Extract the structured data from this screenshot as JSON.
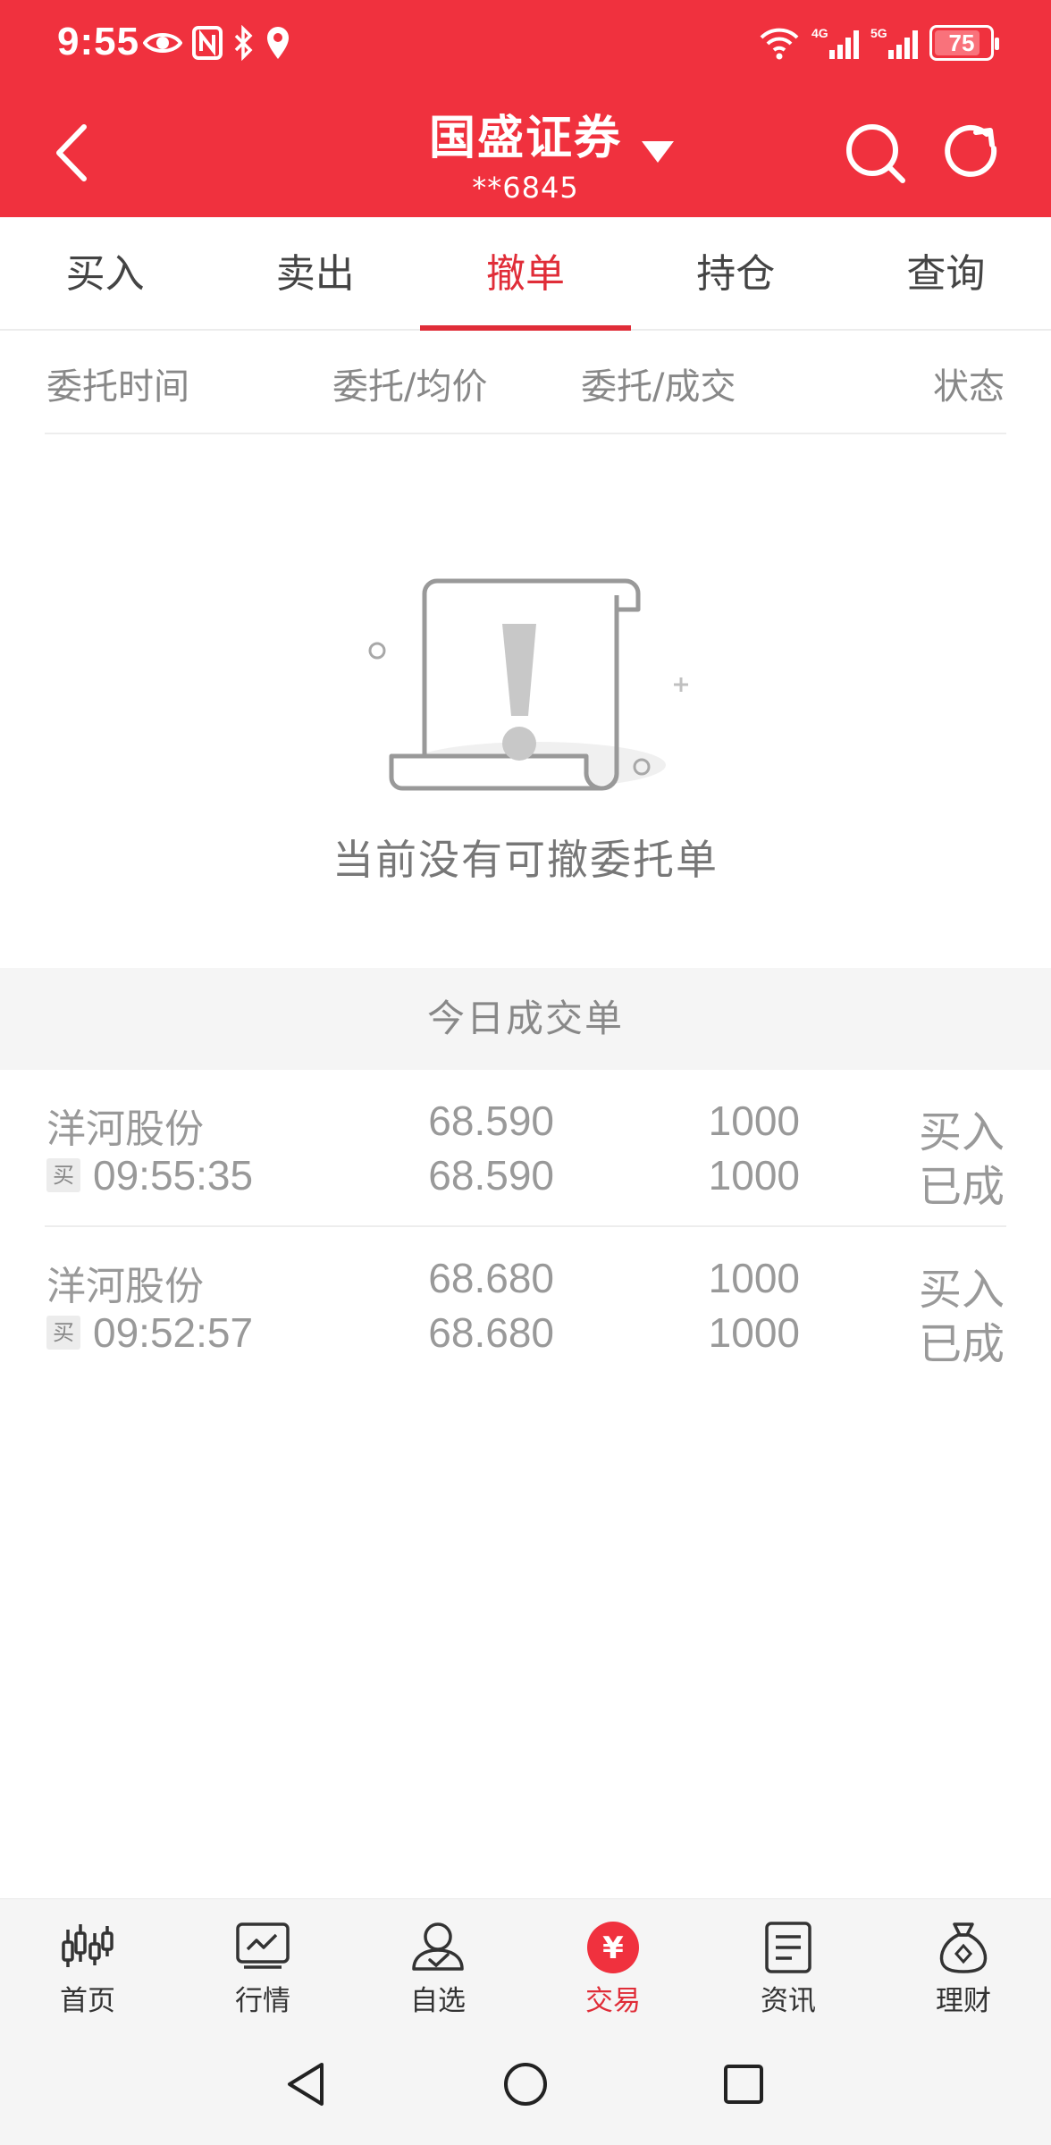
{
  "status_bar": {
    "time": "9:55",
    "battery": "75",
    "signal_a": "4G",
    "signal_b": "5G"
  },
  "header": {
    "title": "国盛证券",
    "account": "**6845"
  },
  "tabs": [
    {
      "label": "买入"
    },
    {
      "label": "卖出"
    },
    {
      "label": "撤单"
    },
    {
      "label": "持仓"
    },
    {
      "label": "查询"
    }
  ],
  "active_tab": "撤单",
  "columns": {
    "time": "委托时间",
    "price": "委托/均价",
    "qty": "委托/成交",
    "status": "状态"
  },
  "empty_message": "当前没有可撤委托单",
  "section_title": "今日成交单",
  "deals": [
    {
      "name": "洋河股份",
      "tag": "买",
      "time": "09:55:35",
      "order_price": "68.590",
      "avg_price": "68.590",
      "order_qty": "1000",
      "deal_qty": "1000",
      "direction": "买入",
      "status": "已成"
    },
    {
      "name": "洋河股份",
      "tag": "买",
      "time": "09:52:57",
      "order_price": "68.680",
      "avg_price": "68.680",
      "order_qty": "1000",
      "deal_qty": "1000",
      "direction": "买入",
      "status": "已成"
    }
  ],
  "bottom_nav": [
    {
      "label": "首页",
      "icon": "candlestick-icon"
    },
    {
      "label": "行情",
      "icon": "chart-icon"
    },
    {
      "label": "自选",
      "icon": "user-check-icon"
    },
    {
      "label": "交易",
      "icon": "yuan-icon",
      "symbol": "¥"
    },
    {
      "label": "资讯",
      "icon": "document-icon"
    },
    {
      "label": "理财",
      "icon": "money-bag-icon"
    }
  ],
  "colors": {
    "brand_red": "#f0313e",
    "active_red": "#e02d38",
    "muted_text": "#999999"
  }
}
